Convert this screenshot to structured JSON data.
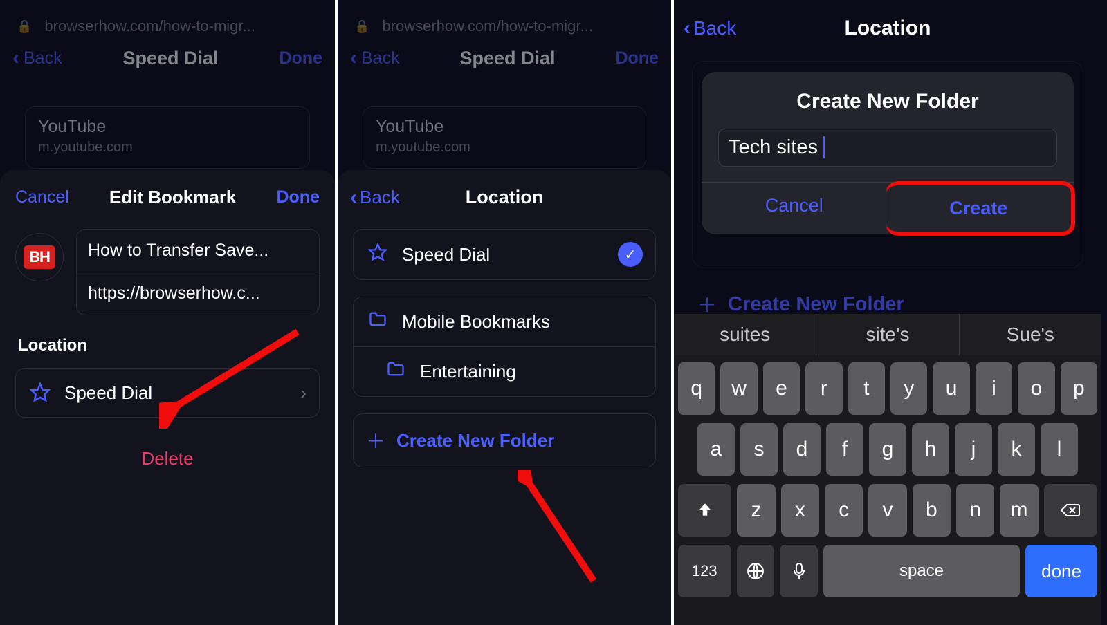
{
  "panel1": {
    "url": "browserhow.com/how-to-migr...",
    "nav": {
      "back": "Back",
      "title": "Speed Dial",
      "done": "Done"
    },
    "bgcard": {
      "title": "YouTube",
      "sub": "m.youtube.com"
    },
    "sheet": {
      "cancel": "Cancel",
      "title": "Edit Bookmark",
      "done": "Done",
      "favicon": "BH",
      "field_title": "How to Transfer Save...",
      "field_url": "https://browserhow.c...",
      "location_label": "Location",
      "location_value": "Speed Dial",
      "delete": "Delete"
    }
  },
  "panel2": {
    "url": "browserhow.com/how-to-migr...",
    "nav": {
      "back": "Back",
      "title": "Speed Dial",
      "done": "Done"
    },
    "bgcard": {
      "title": "YouTube",
      "sub": "m.youtube.com"
    },
    "sheet": {
      "back": "Back",
      "title": "Location",
      "options": [
        {
          "icon": "star",
          "label": "Speed Dial",
          "checked": true,
          "indent": false
        },
        {
          "icon": "folder",
          "label": "Mobile Bookmarks",
          "checked": false,
          "indent": false
        },
        {
          "icon": "folder",
          "label": "Entertaining",
          "checked": false,
          "indent": true
        }
      ],
      "create": "Create New Folder"
    }
  },
  "panel3": {
    "nav": {
      "back": "Back",
      "title": "Location"
    },
    "footer_create": "Create New Folder",
    "dialog": {
      "title": "Create New Folder",
      "input": "Tech sites",
      "cancel": "Cancel",
      "create": "Create"
    },
    "suggestions": [
      "suites",
      "site's",
      "Sue's"
    ],
    "keys_row1": [
      "q",
      "w",
      "e",
      "r",
      "t",
      "y",
      "u",
      "i",
      "o",
      "p"
    ],
    "keys_row2": [
      "a",
      "s",
      "d",
      "f",
      "g",
      "h",
      "j",
      "k",
      "l"
    ],
    "keys_row3": [
      "z",
      "x",
      "c",
      "v",
      "b",
      "n",
      "m"
    ],
    "key_123": "123",
    "key_space": "space",
    "key_done": "done"
  }
}
